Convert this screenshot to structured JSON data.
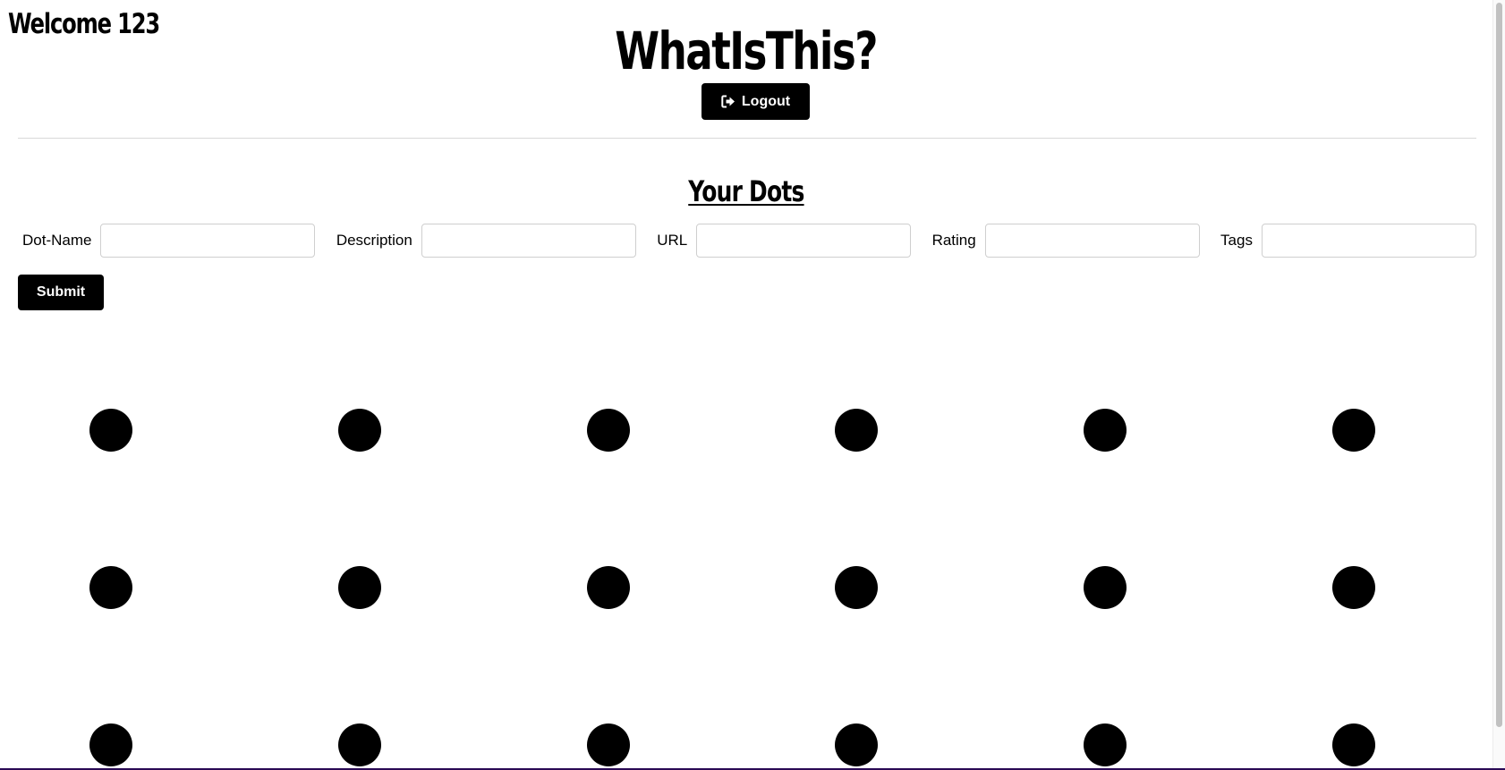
{
  "header": {
    "welcome_text": "Welcome 123",
    "app_title": "WhatIsThis?",
    "logout_label": "Logout",
    "logout_icon": "sign-out-icon"
  },
  "dots_section": {
    "title": "Your Dots"
  },
  "form": {
    "fields": [
      {
        "label": "Dot-Name",
        "value": "",
        "placeholder": ""
      },
      {
        "label": "Description",
        "value": "",
        "placeholder": ""
      },
      {
        "label": "URL",
        "value": "",
        "placeholder": ""
      },
      {
        "label": "Rating",
        "value": "",
        "placeholder": ""
      },
      {
        "label": "Tags",
        "value": "",
        "placeholder": ""
      }
    ],
    "submit_label": "Submit"
  },
  "dots": {
    "rows_visible": 3,
    "columns": 6,
    "color": "#000000"
  },
  "colors": {
    "background": "#ffffff",
    "button_bg": "#000000",
    "button_text": "#ffffff"
  }
}
